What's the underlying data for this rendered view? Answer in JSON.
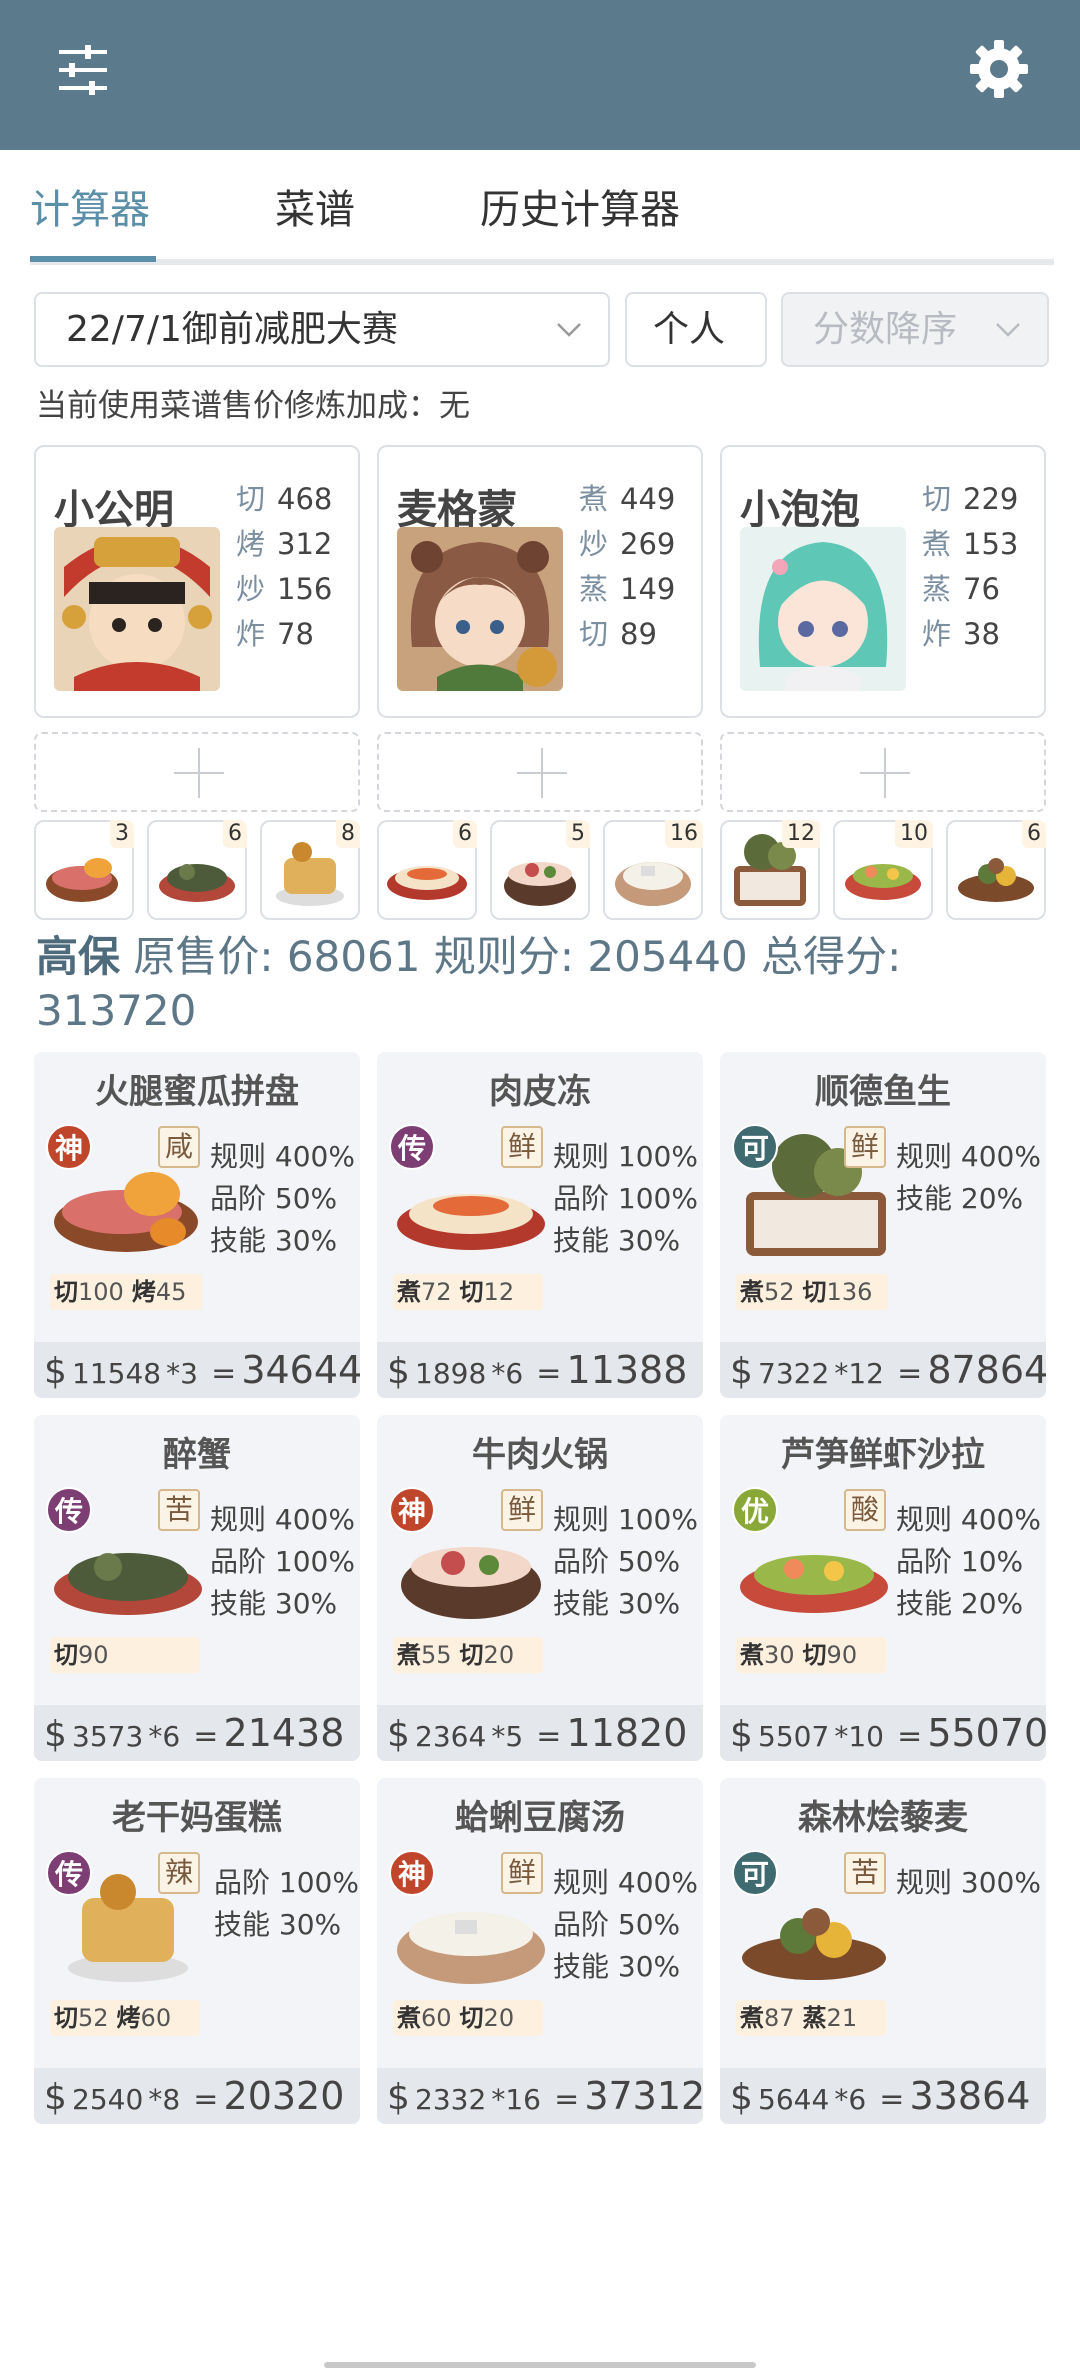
{
  "tabs": [
    "计算器",
    "菜谱",
    "历史计算器"
  ],
  "filters": {
    "contest": "22/7/1御前减肥大赛",
    "mode": "个人",
    "sort": "分数降序"
  },
  "note": "当前使用菜谱售价修炼加成：无",
  "chefs": [
    {
      "name": "小公明",
      "skills": [
        {
          "k": "切",
          "v": "468"
        },
        {
          "k": "烤",
          "v": "312"
        },
        {
          "k": "炒",
          "v": "156"
        },
        {
          "k": "炸",
          "v": "78"
        }
      ]
    },
    {
      "name": "麦格蒙",
      "skills": [
        {
          "k": "煮",
          "v": "449"
        },
        {
          "k": "炒",
          "v": "269"
        },
        {
          "k": "蒸",
          "v": "149"
        },
        {
          "k": "切",
          "v": "89"
        }
      ]
    },
    {
      "name": "小泡泡",
      "skills": [
        {
          "k": "切",
          "v": "229"
        },
        {
          "k": "煮",
          "v": "153"
        },
        {
          "k": "蒸",
          "v": "76"
        },
        {
          "k": "炸",
          "v": "38"
        }
      ]
    }
  ],
  "dish_counts": [
    "3",
    "6",
    "8",
    "6",
    "5",
    "16",
    "12",
    "10",
    "6"
  ],
  "summary": {
    "label": "高保",
    "orig_label": "原售价:",
    "orig": "68061",
    "rule_label": "规则分:",
    "rule": "205440",
    "total_label": "总得分:",
    "total": "313720"
  },
  "recipes": [
    {
      "name": "火腿蜜瓜拼盘",
      "rarity": "神",
      "flavor": "咸",
      "bonuses": [
        "规则 400%",
        "品阶 50%",
        "技能 30%"
      ],
      "reqs": [
        {
          "k": "切",
          "v": "100"
        },
        {
          "k": "烤",
          "v": "45"
        }
      ],
      "price": "11548",
      "mult": "*3",
      "total": "34644"
    },
    {
      "name": "肉皮冻",
      "rarity": "传",
      "flavor": "鲜",
      "bonuses": [
        "规则 100%",
        "品阶 100%",
        "技能 30%"
      ],
      "reqs": [
        {
          "k": "煮",
          "v": "72"
        },
        {
          "k": "切",
          "v": "12"
        }
      ],
      "price": "1898",
      "mult": "*6",
      "total": "11388"
    },
    {
      "name": "顺德鱼生",
      "rarity": "可",
      "flavor": "鲜",
      "bonuses": [
        "规则 400%",
        "技能 20%"
      ],
      "reqs": [
        {
          "k": "煮",
          "v": "52"
        },
        {
          "k": "切",
          "v": "136"
        }
      ],
      "price": "7322",
      "mult": "*12",
      "total": "87864"
    },
    {
      "name": "醉蟹",
      "rarity": "传",
      "flavor": "苦",
      "bonuses": [
        "规则 400%",
        "品阶 100%",
        "技能 30%"
      ],
      "reqs": [
        {
          "k": "切",
          "v": "90"
        }
      ],
      "price": "3573",
      "mult": "*6",
      "total": "21438"
    },
    {
      "name": "牛肉火锅",
      "rarity": "神",
      "flavor": "鲜",
      "bonuses": [
        "规则 100%",
        "品阶 50%",
        "技能 30%"
      ],
      "reqs": [
        {
          "k": "煮",
          "v": "55"
        },
        {
          "k": "切",
          "v": "20"
        }
      ],
      "price": "2364",
      "mult": "*5",
      "total": "11820"
    },
    {
      "name": "芦笋鲜虾沙拉",
      "rarity": "优",
      "flavor": "酸",
      "bonuses": [
        "规则 400%",
        "品阶 10%",
        "技能 20%"
      ],
      "reqs": [
        {
          "k": "煮",
          "v": "30"
        },
        {
          "k": "切",
          "v": "90"
        }
      ],
      "price": "5507",
      "mult": "*10",
      "total": "55070"
    },
    {
      "name": "老干妈蛋糕",
      "rarity": "传",
      "flavor": "辣",
      "bonuses": [
        "品阶 100%",
        "技能 30%"
      ],
      "reqs": [
        {
          "k": "切",
          "v": "52"
        },
        {
          "k": "烤",
          "v": "60"
        }
      ],
      "price": "2540",
      "mult": "*8",
      "total": "20320"
    },
    {
      "name": "蛤蜊豆腐汤",
      "rarity": "神",
      "flavor": "鲜",
      "bonuses": [
        "规则 400%",
        "品阶 50%",
        "技能 30%"
      ],
      "reqs": [
        {
          "k": "煮",
          "v": "60"
        },
        {
          "k": "切",
          "v": "20"
        }
      ],
      "price": "2332",
      "mult": "*16",
      "total": "37312"
    },
    {
      "name": "森林烩藜麦",
      "rarity": "可",
      "flavor": "苦",
      "bonuses": [
        "规则 300%"
      ],
      "reqs": [
        {
          "k": "煮",
          "v": "87"
        },
        {
          "k": "蒸",
          "v": "21"
        }
      ],
      "price": "5644",
      "mult": "*6",
      "total": "33864"
    }
  ],
  "colors": {
    "header": "#5b7a8c",
    "accent": "#5b8fa8",
    "rarity_god": "#c0462b",
    "rarity_legend": "#7d3f73",
    "rarity_ok": "#3f6a6f",
    "rarity_good": "#8aa838"
  },
  "icons": {
    "menu": "sliders-icon",
    "settings": "gear-icon"
  }
}
